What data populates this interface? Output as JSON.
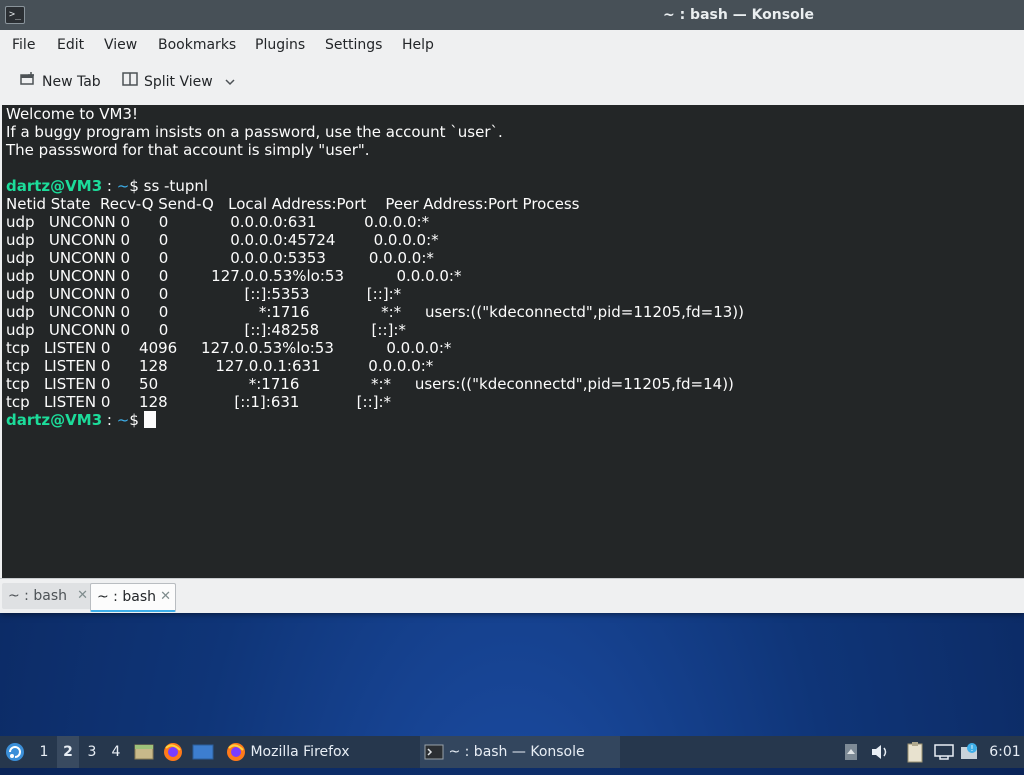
{
  "window": {
    "title": "~ : bash — Konsole",
    "app_icon_glyph": ">_"
  },
  "menubar": {
    "items": [
      "File",
      "Edit",
      "View",
      "Bookmarks",
      "Plugins",
      "Settings",
      "Help"
    ]
  },
  "toolbar": {
    "new_tab_label": "New Tab",
    "split_view_label": "Split View"
  },
  "terminal": {
    "welcome": [
      "Welcome to VM3!",
      "If a buggy program insists on a password, use the account `user`.",
      "The passsword for that account is simply \"user\"."
    ],
    "prompt_user": "dartz@VM3",
    "prompt_sep": " : ",
    "prompt_path": "~",
    "prompt_symbol": "$ ",
    "command": "ss -tupnl",
    "header": "Netid State  Recv-Q Send-Q   Local Address:Port    Peer Address:Port Process",
    "rows": [
      "udp   UNCONN 0      0             0.0.0.0:631          0.0.0.0:*",
      "udp   UNCONN 0      0             0.0.0.0:45724        0.0.0.0:*",
      "udp   UNCONN 0      0             0.0.0.0:5353         0.0.0.0:*",
      "udp   UNCONN 0      0         127.0.0.53%lo:53           0.0.0.0:*",
      "udp   UNCONN 0      0                [::]:5353            [::]:*",
      "udp   UNCONN 0      0                   *:1716               *:*     users:((\"kdeconnectd\",pid=11205,fd=13))",
      "udp   UNCONN 0      0                [::]:48258           [::]:*",
      "tcp   LISTEN 0      4096     127.0.0.53%lo:53           0.0.0.0:*",
      "tcp   LISTEN 0      128          127.0.0.1:631          0.0.0.0:*",
      "tcp   LISTEN 0      50                   *:1716               *:*     users:((\"kdeconnectd\",pid=11205,fd=14))",
      "tcp   LISTEN 0      128              [::1]:631            [::]:*"
    ]
  },
  "tabs": [
    {
      "label": "~ : bash",
      "active": false
    },
    {
      "label": "~ : bash",
      "active": true
    }
  ],
  "taskbar": {
    "workspaces": [
      "1",
      "2",
      "3",
      "4"
    ],
    "active_workspace": "2",
    "launchers": [
      "file-manager-icon",
      "firefox-icon",
      "desktop-icon"
    ],
    "tasks": [
      {
        "label": "Mozilla Firefox",
        "icon": "firefox-icon"
      },
      {
        "label": "~ : bash — Konsole",
        "icon": "terminal-icon"
      }
    ],
    "clock": "6:01"
  },
  "colors": {
    "prompt_user": "#1cdc9a",
    "prompt_path": "#3daee9",
    "terminal_bg": "#232627",
    "titlebar_bg": "#475057",
    "taskbar_bg": "#26374d"
  }
}
